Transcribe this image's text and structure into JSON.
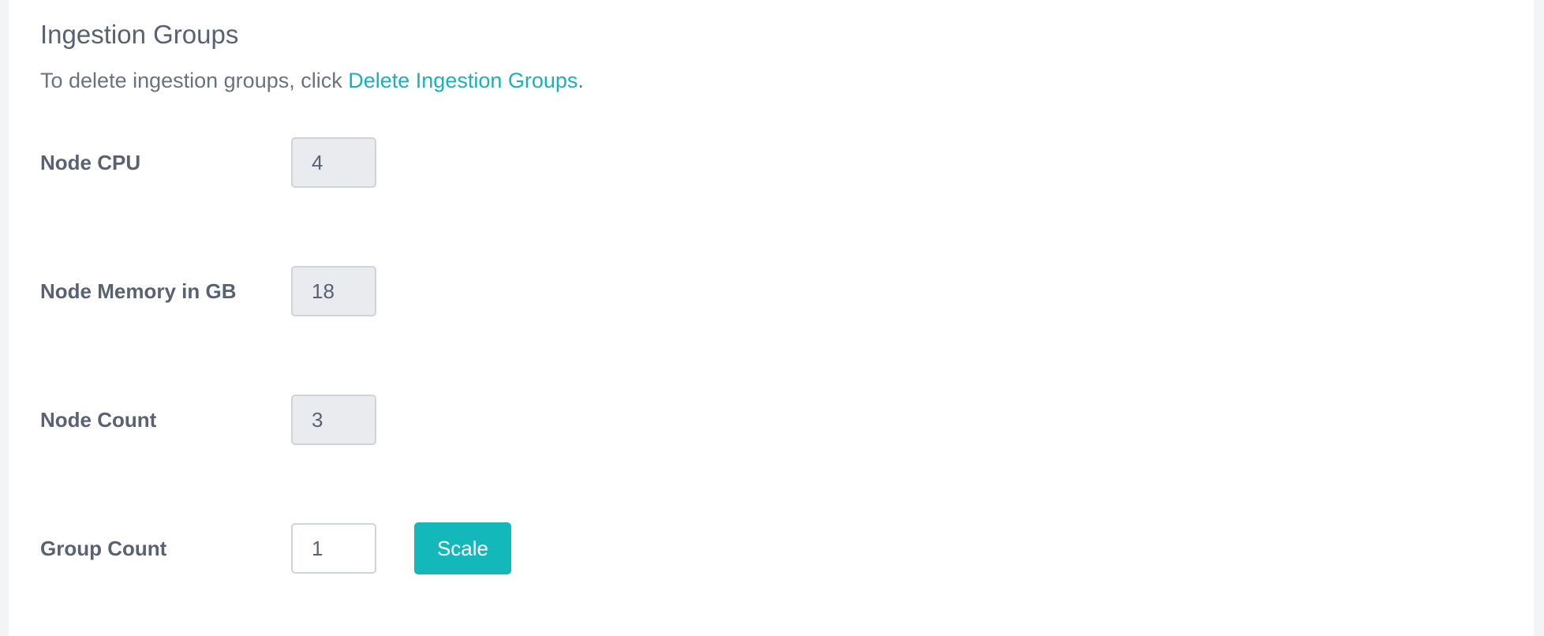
{
  "section": {
    "title": "Ingestion Groups",
    "description_prefix": "To delete ingestion groups, click ",
    "delete_link_label": "Delete Ingestion Groups",
    "description_suffix": "."
  },
  "fields": {
    "node_cpu": {
      "label": "Node CPU",
      "value": "4"
    },
    "node_memory": {
      "label": "Node Memory in GB",
      "value": "18"
    },
    "node_count": {
      "label": "Node Count",
      "value": "3"
    },
    "group_count": {
      "label": "Group Count",
      "value": "1"
    }
  },
  "actions": {
    "scale_label": "Scale"
  },
  "colors": {
    "accent": "#13b8bb",
    "text": "#596273",
    "readonly_bg": "#e9ebee",
    "page_bg": "#f3f4f6"
  }
}
